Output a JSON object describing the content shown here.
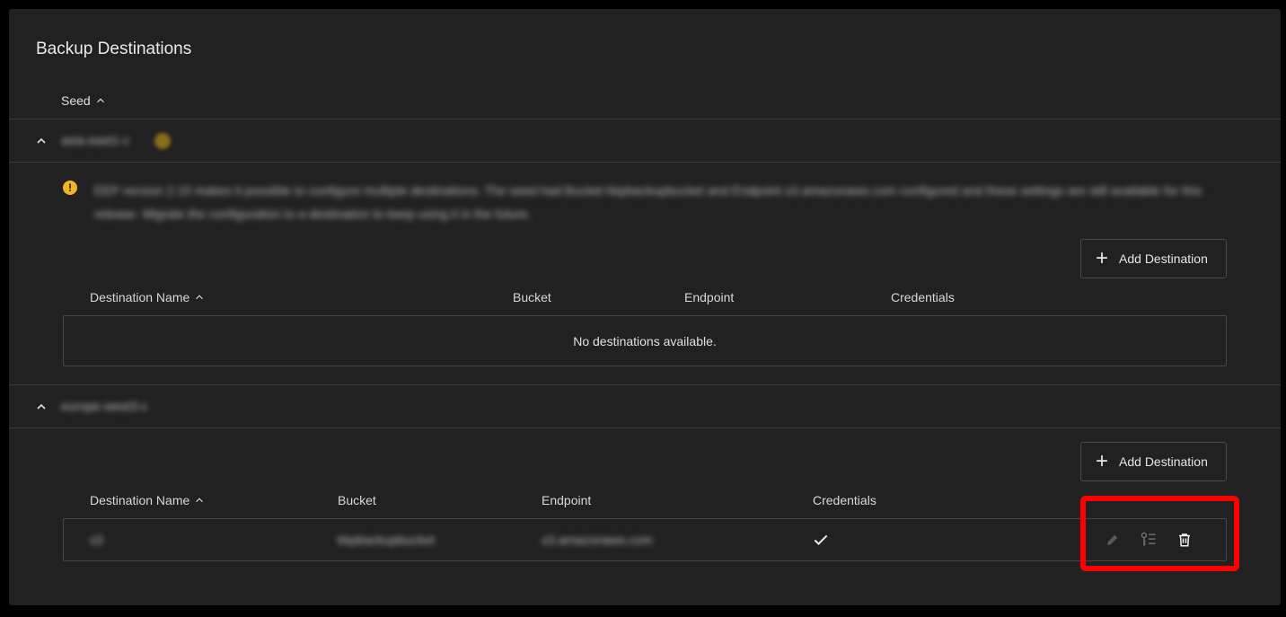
{
  "page": {
    "title": "Backup Destinations"
  },
  "seed_table": {
    "column_seed": "Seed"
  },
  "seeds": [
    {
      "name": "asia-east1-c",
      "warning_text": "EEP version 2.15 makes it possible to configure multiple destinations. The seed had Bucket kkpbackupbucket and Endpoint s3.amazonaws.com configured and these settings are still available for this release. Migrate the configuration to a destination to keep using it in the future.",
      "add_button": "Add Destination",
      "columns": {
        "name": "Destination Name",
        "bucket": "Bucket",
        "endpoint": "Endpoint",
        "credentials": "Credentials"
      },
      "empty_text": "No destinations available."
    },
    {
      "name": "europe-west3-c",
      "add_button": "Add Destination",
      "columns": {
        "name": "Destination Name",
        "bucket": "Bucket",
        "endpoint": "Endpoint",
        "credentials": "Credentials"
      },
      "rows": [
        {
          "name": "s3",
          "bucket": "kkpbackupbucket",
          "endpoint": "s3.amazonaws.com",
          "credentials_icon": "check-icon"
        }
      ]
    }
  ],
  "colors": {
    "background": "#212121",
    "border": "#3d3d3d",
    "warning": "#f0b429",
    "highlight": "#ff0000"
  }
}
